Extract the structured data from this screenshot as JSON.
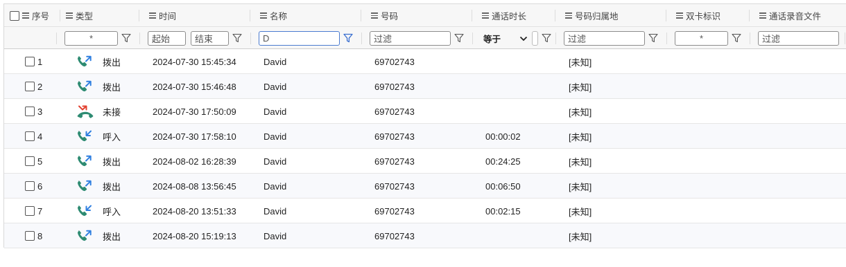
{
  "columns": [
    {
      "key": "seq",
      "label": "序号"
    },
    {
      "key": "type",
      "label": "类型"
    },
    {
      "key": "time",
      "label": "时间"
    },
    {
      "key": "name",
      "label": "名称"
    },
    {
      "key": "number",
      "label": "号码"
    },
    {
      "key": "duration",
      "label": "通话时长"
    },
    {
      "key": "location",
      "label": "号码归属地"
    },
    {
      "key": "sim",
      "label": "双卡标识"
    },
    {
      "key": "recording",
      "label": "通话录音文件"
    }
  ],
  "filters": {
    "type": "*",
    "time_start": "起始",
    "time_end": "结束",
    "name": "D",
    "number_placeholder": "过滤",
    "duration_op": "等于",
    "location_placeholder": "过滤",
    "sim": "*",
    "recording_placeholder": "过滤"
  },
  "rows": [
    {
      "seq": "1",
      "type": "拨出",
      "icon": "outgoing-call-icon",
      "time": "2024-07-30 15:45:34",
      "name": "David",
      "number": "69702743",
      "duration": "",
      "location": "[未知]"
    },
    {
      "seq": "2",
      "type": "拨出",
      "icon": "outgoing-call-icon",
      "time": "2024-07-30 15:46:48",
      "name": "David",
      "number": "69702743",
      "duration": "",
      "location": "[未知]"
    },
    {
      "seq": "3",
      "type": "未接",
      "icon": "missed-call-icon",
      "time": "2024-07-30 17:50:09",
      "name": "David",
      "number": "69702743",
      "duration": "",
      "location": "[未知]"
    },
    {
      "seq": "4",
      "type": "呼入",
      "icon": "incoming-call-icon",
      "time": "2024-07-30 17:58:10",
      "name": "David",
      "number": "69702743",
      "duration": "00:00:02",
      "location": "[未知]"
    },
    {
      "seq": "5",
      "type": "拨出",
      "icon": "outgoing-call-icon",
      "time": "2024-08-02 16:28:39",
      "name": "David",
      "number": "69702743",
      "duration": "00:24:25",
      "location": "[未知]"
    },
    {
      "seq": "6",
      "type": "拨出",
      "icon": "outgoing-call-icon",
      "time": "2024-08-08 13:56:45",
      "name": "David",
      "number": "69702743",
      "duration": "00:06:50",
      "location": "[未知]"
    },
    {
      "seq": "7",
      "type": "呼入",
      "icon": "incoming-call-icon",
      "time": "2024-08-20 13:51:33",
      "name": "David",
      "number": "69702743",
      "duration": "00:02:15",
      "location": "[未知]"
    },
    {
      "seq": "8",
      "type": "拨出",
      "icon": "outgoing-call-icon",
      "time": "2024-08-20 15:19:13",
      "name": "David",
      "number": "69702743",
      "duration": "",
      "location": "[未知]"
    }
  ],
  "colors": {
    "handset": "#2e8b72",
    "outgoing_arrow": "#2f7fe0",
    "missed_arrow": "#e2402f",
    "filter_active": "#3a6fd0"
  }
}
